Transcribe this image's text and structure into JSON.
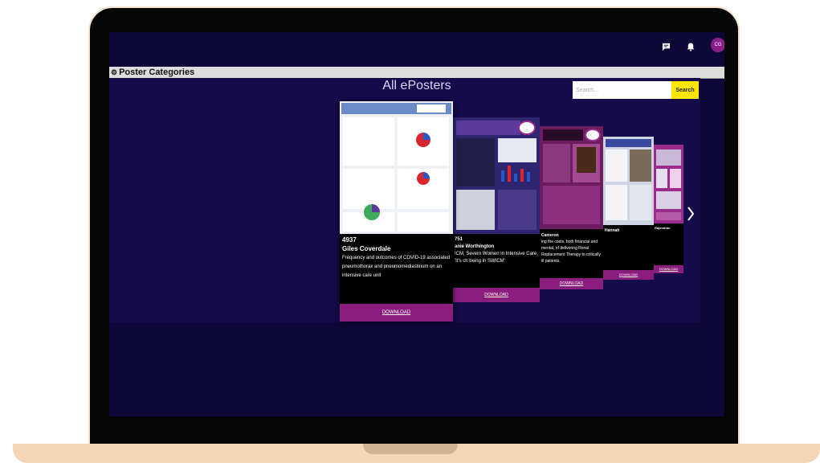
{
  "header": {
    "avatar_initials": "CG",
    "icons": [
      "chat-icon",
      "bell-icon"
    ]
  },
  "categories_bar": {
    "label": "Poster Categories"
  },
  "page": {
    "title": "All ePosters"
  },
  "search": {
    "placeholder": "Search...",
    "button_label": "Search"
  },
  "posters": [
    {
      "id": "4937",
      "author": "Giles Coverdale",
      "title": "Frequency and outcomes of COVID-19 associated pneumothorax and pneumomediastinum on an intensive care unit",
      "download_label": "DOWNLOAD"
    },
    {
      "id": "751",
      "author": "anie Worthington",
      "title": "ICM, Severn Women in Intensive Care, 'It's ch being in SWICM'",
      "download_label": "DOWNLOAD"
    },
    {
      "id": "",
      "author": "Cameron",
      "title": "ing the costs, both financial and mental, of delivering Renal Replacement Therapy to critically ill patients.",
      "download_label": "DOWNLOAD"
    },
    {
      "id": "",
      "author": "Hannah",
      "title": "",
      "download_label": "DOWNLOAD"
    },
    {
      "id": "",
      "author": "Rajendran",
      "title": "",
      "download_label": "DOWNLOAD"
    }
  ],
  "colors": {
    "screen_bg": "#0e0838",
    "content_bg": "#150a4a",
    "accent_magenta": "#8a1d7d",
    "search_button": "#ffe600",
    "laptop_base": "#f2d6b6"
  }
}
